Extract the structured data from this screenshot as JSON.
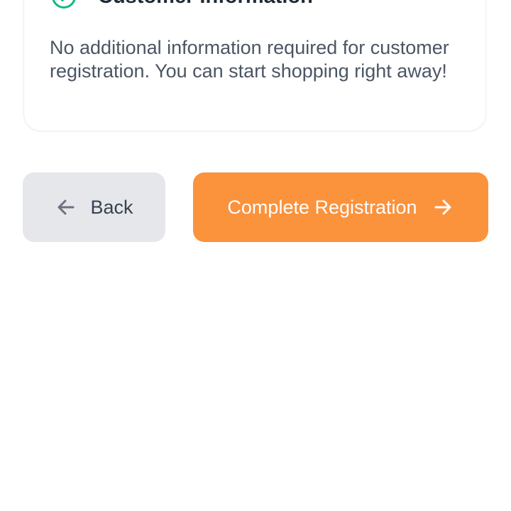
{
  "customer_info_card": {
    "title": "Customer Information",
    "status_icon": "check-circle-icon",
    "message": "No additional information required for customer registration. You can start shopping right away!"
  },
  "actions": {
    "back_label": "Back",
    "back_icon": "arrow-left-icon",
    "complete_label": "Complete Registration",
    "complete_icon": "arrow-right-icon"
  },
  "colors": {
    "accent": "#fb923c",
    "success": "#10b981",
    "back_button_bg": "#e5e7eb"
  }
}
